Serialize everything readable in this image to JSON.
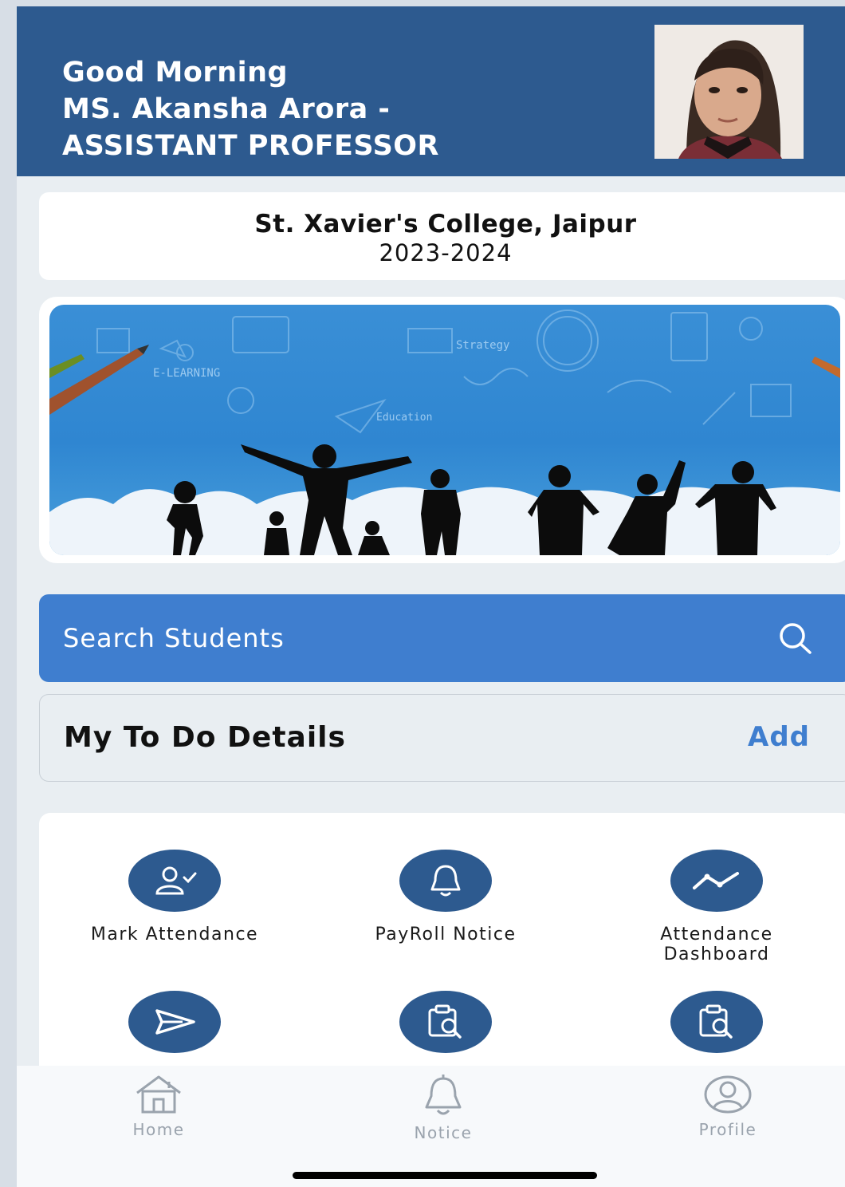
{
  "header": {
    "greeting": "Good Morning",
    "name_line": "MS. Akansha  Arora -",
    "role_line": "ASSISTANT PROFESSOR",
    "avatar_icon": "profile-photo"
  },
  "college": {
    "name": "St. Xavier's College, Jaipur",
    "session": "2023-2024"
  },
  "banner": {
    "icon": "education-banner-illustration"
  },
  "search": {
    "label": "Search Students",
    "icon": "search-icon"
  },
  "todo": {
    "title": "My To Do Details",
    "add_label": "Add"
  },
  "menu": {
    "items": [
      {
        "label": "Mark Attendance",
        "icon": "user-check-icon"
      },
      {
        "label": "PayRoll Notice",
        "icon": "bell-icon"
      },
      {
        "label_line1": "Attendance",
        "label_line2": "Dashboard",
        "icon": "trend-icon"
      },
      {
        "label": "",
        "icon": "send-icon"
      },
      {
        "label": "",
        "icon": "clipboard-search-icon"
      },
      {
        "label": "",
        "icon": "clipboard-search-icon"
      }
    ]
  },
  "bottom_nav": {
    "items": [
      {
        "label": "Home",
        "icon": "home-icon"
      },
      {
        "label": "Notice",
        "icon": "bell-icon"
      },
      {
        "label": "Profile",
        "icon": "profile-icon"
      }
    ]
  },
  "colors": {
    "header": "#2d5a8f",
    "accent": "#3f7ecf",
    "background": "#e9eef2"
  }
}
